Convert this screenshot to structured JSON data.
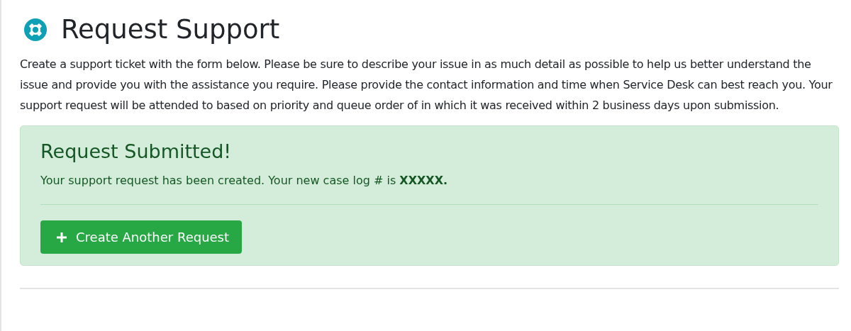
{
  "page": {
    "title": "Request Support",
    "intro": "Create a support ticket with the form below. Please be sure to describe your issue in as much detail as possible to help us better understand the issue and provide you with the assistance you require. Please provide the contact information and time when Service Desk can best reach you. Your support request will be attended to based on priority and queue order of in which it was received within 2 business days upon submission."
  },
  "alert": {
    "kind": "success",
    "title": "Request Submitted!",
    "message": "Your support request has been created. Your new case log # is **XXXXX.**",
    "button": {
      "label": "Create Another Request"
    }
  }
}
